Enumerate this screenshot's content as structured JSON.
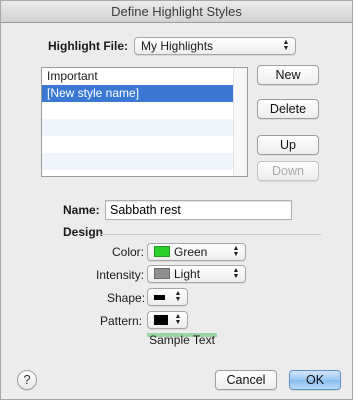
{
  "window": {
    "title": "Define Highlight Styles"
  },
  "highlight_file": {
    "label": "Highlight File:",
    "value": "My Highlights"
  },
  "styles_list": {
    "items": [
      {
        "label": "Important",
        "selected": false
      },
      {
        "label": "[New style name]",
        "selected": true
      },
      {
        "label": "",
        "selected": false
      },
      {
        "label": "",
        "selected": false
      },
      {
        "label": "",
        "selected": false
      },
      {
        "label": "",
        "selected": false
      }
    ]
  },
  "buttons": {
    "new": "New",
    "delete": "Delete",
    "up": "Up",
    "down": "Down",
    "cancel": "Cancel",
    "ok": "OK",
    "help": "?"
  },
  "name": {
    "label": "Name:",
    "value": "Sabbath rest"
  },
  "design": {
    "heading": "Design",
    "color": {
      "label": "Color:",
      "value": "Green",
      "swatch": "#2bd12b"
    },
    "intensity": {
      "label": "Intensity:",
      "value": "Light",
      "swatch": "#8f8f8f"
    },
    "shape": {
      "label": "Shape:",
      "swatch": "#000000"
    },
    "pattern": {
      "label": "Pattern:",
      "swatch": "#000000"
    }
  },
  "sample": {
    "text": "Sample Text",
    "highlight": "#9ad6a3"
  },
  "colors": {
    "selection": "#3b78d4",
    "ok_accent": "#86bcee"
  }
}
